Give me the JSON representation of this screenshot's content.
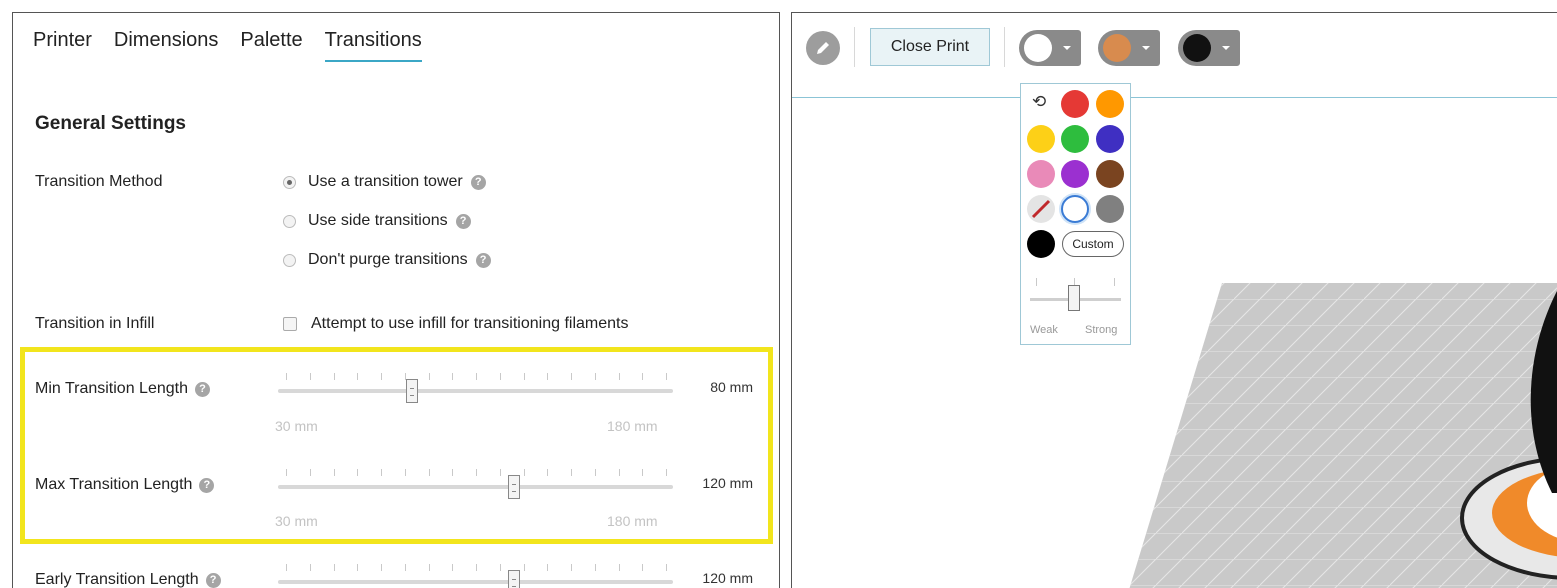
{
  "settings": {
    "tabs": [
      {
        "label": "Printer"
      },
      {
        "label": "Dimensions"
      },
      {
        "label": "Palette"
      },
      {
        "label": "Transitions",
        "active": true
      }
    ],
    "section_title": "General Settings",
    "transition_method": {
      "label": "Transition Method",
      "options": [
        {
          "label": "Use a transition tower",
          "selected": true
        },
        {
          "label": "Use side transitions",
          "selected": false
        },
        {
          "label": "Don't purge transitions",
          "selected": false
        }
      ]
    },
    "transition_in_infill": {
      "label": "Transition in Infill",
      "checkbox_label": "Attempt to use infill for transitioning filaments",
      "checked": false
    },
    "sliders": [
      {
        "label": "Min Transition Length",
        "value": "80 mm",
        "min_label": "30 mm",
        "max_label": "180 mm",
        "fraction": 0.333
      },
      {
        "label": "Max Transition Length",
        "value": "120 mm",
        "min_label": "30 mm",
        "max_label": "180 mm",
        "fraction": 0.6
      },
      {
        "label": "Early Transition Length",
        "value": "120 mm",
        "fraction": 0.6
      }
    ],
    "help_glyph": "?"
  },
  "viewer": {
    "close_print_label": "Close Print",
    "color_dropdowns": [
      {
        "color": "#ffffff"
      },
      {
        "color": "#d88b4e"
      },
      {
        "color": "#111111"
      }
    ],
    "palette": {
      "reset_glyph": "⟲",
      "swatches": [
        "#e53935",
        "#ff9800",
        "#fdd017",
        "#2ebd3e",
        "#3f2fc2",
        "#e98ab8",
        "#9b30d0",
        "#7a4420",
        "#ffffff",
        "#808080",
        "#000000"
      ],
      "custom_label": "Custom",
      "weak_label": "Weak",
      "strong_label": "Strong",
      "strength_fraction": 0.5
    }
  }
}
